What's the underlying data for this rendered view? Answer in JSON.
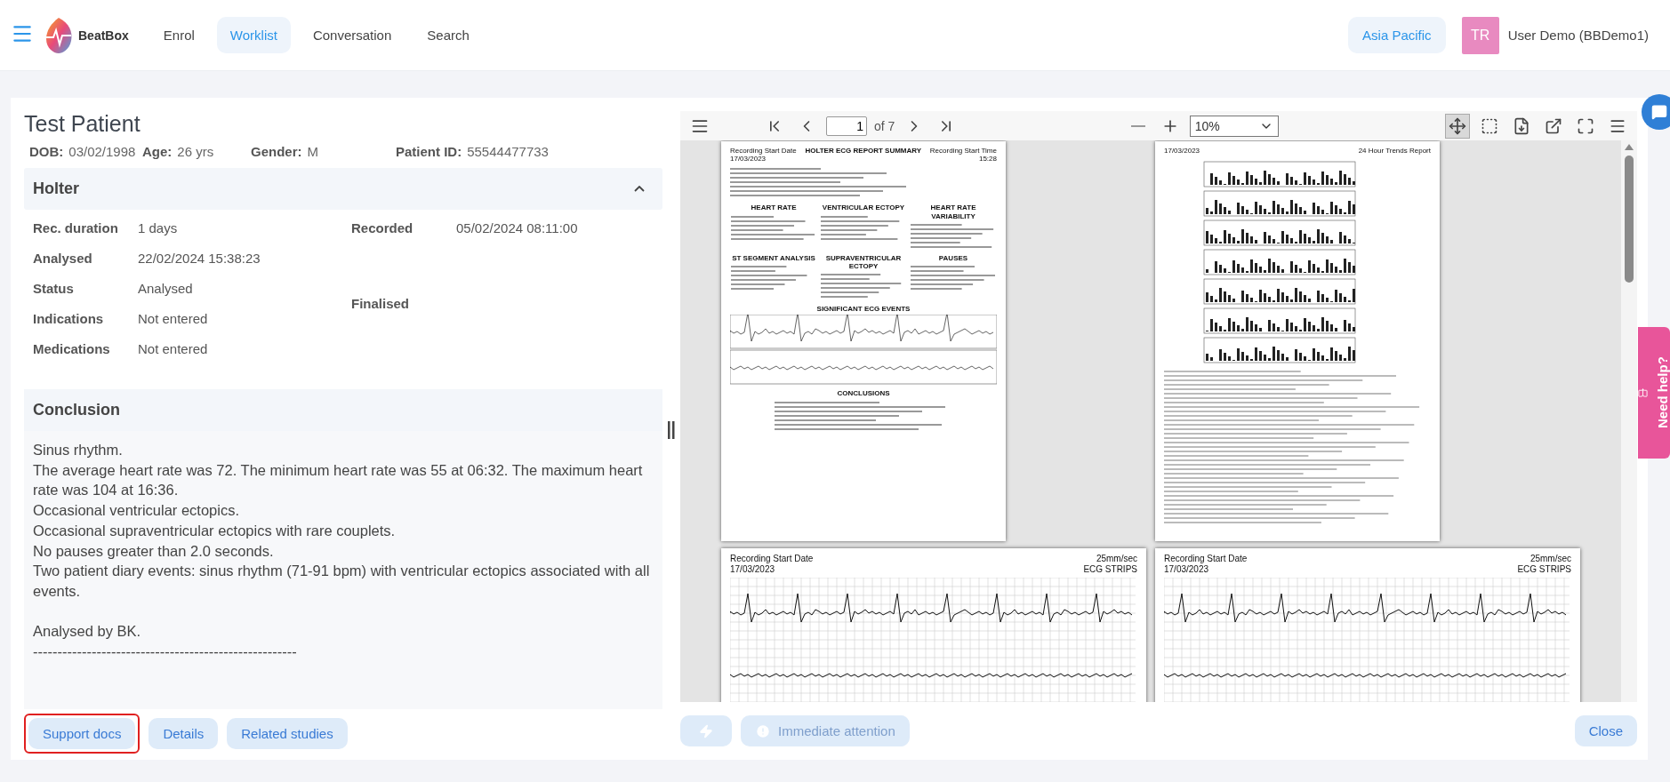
{
  "header": {
    "brand": "BeatBox",
    "nav": [
      {
        "label": "Enrol",
        "selected": false
      },
      {
        "label": "Worklist",
        "selected": true
      },
      {
        "label": "Conversation",
        "selected": false
      },
      {
        "label": "Search",
        "selected": false
      }
    ],
    "region": "Asia Pacific",
    "avatar_initials": "TR",
    "user": "User Demo (BBDemo1)"
  },
  "patient": {
    "name": "Test Patient",
    "info": [
      {
        "label": "DOB:",
        "value": "03/02/1998"
      },
      {
        "label": "Age:",
        "value": "26 yrs"
      },
      {
        "label": "Gender:",
        "value": "M"
      },
      {
        "label": "Patient ID:",
        "value": "55544477733"
      }
    ]
  },
  "holter": {
    "title": "Holter",
    "expanded": true,
    "left_fields": [
      {
        "label": "Rec. duration",
        "value": "1 days"
      },
      {
        "label": "Analysed",
        "value": "22/02/2024 15:38:23"
      },
      {
        "label": "Status",
        "value": "Analysed"
      },
      {
        "label": "Indications",
        "value": "Not entered"
      },
      {
        "label": "Medications",
        "value": "Not entered"
      }
    ],
    "right_fields": [
      {
        "label": "Recorded",
        "value": "05/02/2024 08:11:00"
      },
      {
        "label": "Finalised"
      }
    ]
  },
  "conclusion": {
    "title": "Conclusion",
    "paragraphs": [
      [
        "Sinus rhythm.",
        "The average heart rate was 72. The minimum heart rate was 55 at 06:32. The maximum heart rate was 104 at 16:36.",
        "Occasional ventricular ectopics.",
        "Occasional supraventricular ectopics with rare couplets.",
        "No pauses greater than 2.0 seconds.",
        "Two patient diary events: sinus rhythm (71-91 bpm) with ventricular ectopics associated with all events."
      ],
      [
        "Analysed by BK.",
        "------------------------------------------------------"
      ]
    ]
  },
  "left_buttons": [
    {
      "label": "Support docs",
      "highlighted": true
    },
    {
      "label": "Details",
      "highlighted": false
    },
    {
      "label": "Related studies",
      "highlighted": false
    }
  ],
  "viewer": {
    "page": "1",
    "page_count": "of 7",
    "zoom": "10%",
    "tools": [
      {
        "kind": "pan",
        "selected": true
      },
      {
        "kind": "select",
        "selected": false
      },
      {
        "kind": "download",
        "selected": false
      },
      {
        "kind": "open",
        "selected": false
      },
      {
        "kind": "fullscreen",
        "selected": false
      },
      {
        "kind": "menu",
        "selected": false
      }
    ],
    "pages": [
      {
        "kind": "summary",
        "left": [
          "Recording Start Date",
          "17/03/2023"
        ],
        "center": "HOLTER ECG REPORT SUMMARY",
        "right": [
          "Recording Start Time",
          "15:28"
        ],
        "sections": [
          "HEART RATE",
          "VENTRICULAR ECTOPY",
          "HEART RATE VARIABILITY",
          "ST SEGMENT ANALYSIS",
          "SUPRAVENTRICULAR ECTOPY",
          "PAUSES",
          "SIGNIFICANT ECG EVENTS",
          "CONCLUSIONS"
        ]
      },
      {
        "kind": "trends",
        "left": [
          "17/03/2023"
        ],
        "right": [
          "24 Hour Trends Report"
        ]
      },
      {
        "kind": "strip",
        "left": [
          "Recording Start Date",
          "17/03/2023"
        ],
        "right": [
          "25mm/sec",
          "ECG STRIPS"
        ]
      },
      {
        "kind": "strip",
        "left": [
          "Recording Start Date",
          "17/03/2023"
        ],
        "right": [
          "25mm/sec",
          "ECG STRIPS"
        ]
      }
    ]
  },
  "viewer_buttons": [
    {
      "kind": "icon",
      "disabled": true
    },
    {
      "kind": "text",
      "label": "Immediate attention",
      "disabled": true
    }
  ],
  "close_button": "Close",
  "help_tab": "Need help?"
}
